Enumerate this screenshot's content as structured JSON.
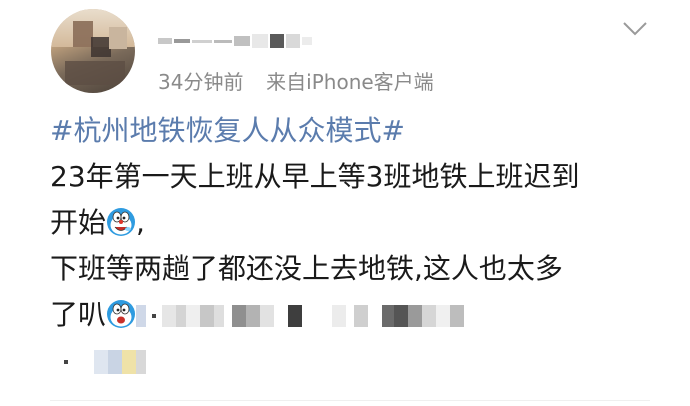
{
  "post": {
    "time": "34分钟前",
    "source": "来自",
    "source_app": "iPhone客户端",
    "hashtag": "#杭州地铁恢复人从众模式#",
    "line1": "23年第一天上班从早上等3班地铁上班迟到",
    "line2_text": "开始",
    "line2_suffix": ",",
    "line3": "下班等两趟了都还没上去地铁,这人也太多",
    "line4_text": "了叭"
  },
  "icons": {
    "more": "chevron-down-icon",
    "emoji_line2": "doraemon-emoji",
    "emoji_line4": "doraemon-emoji"
  },
  "colors": {
    "hashtag": "#5b7cad",
    "meta": "#8a8a8a",
    "text": "#1a1a1a"
  }
}
